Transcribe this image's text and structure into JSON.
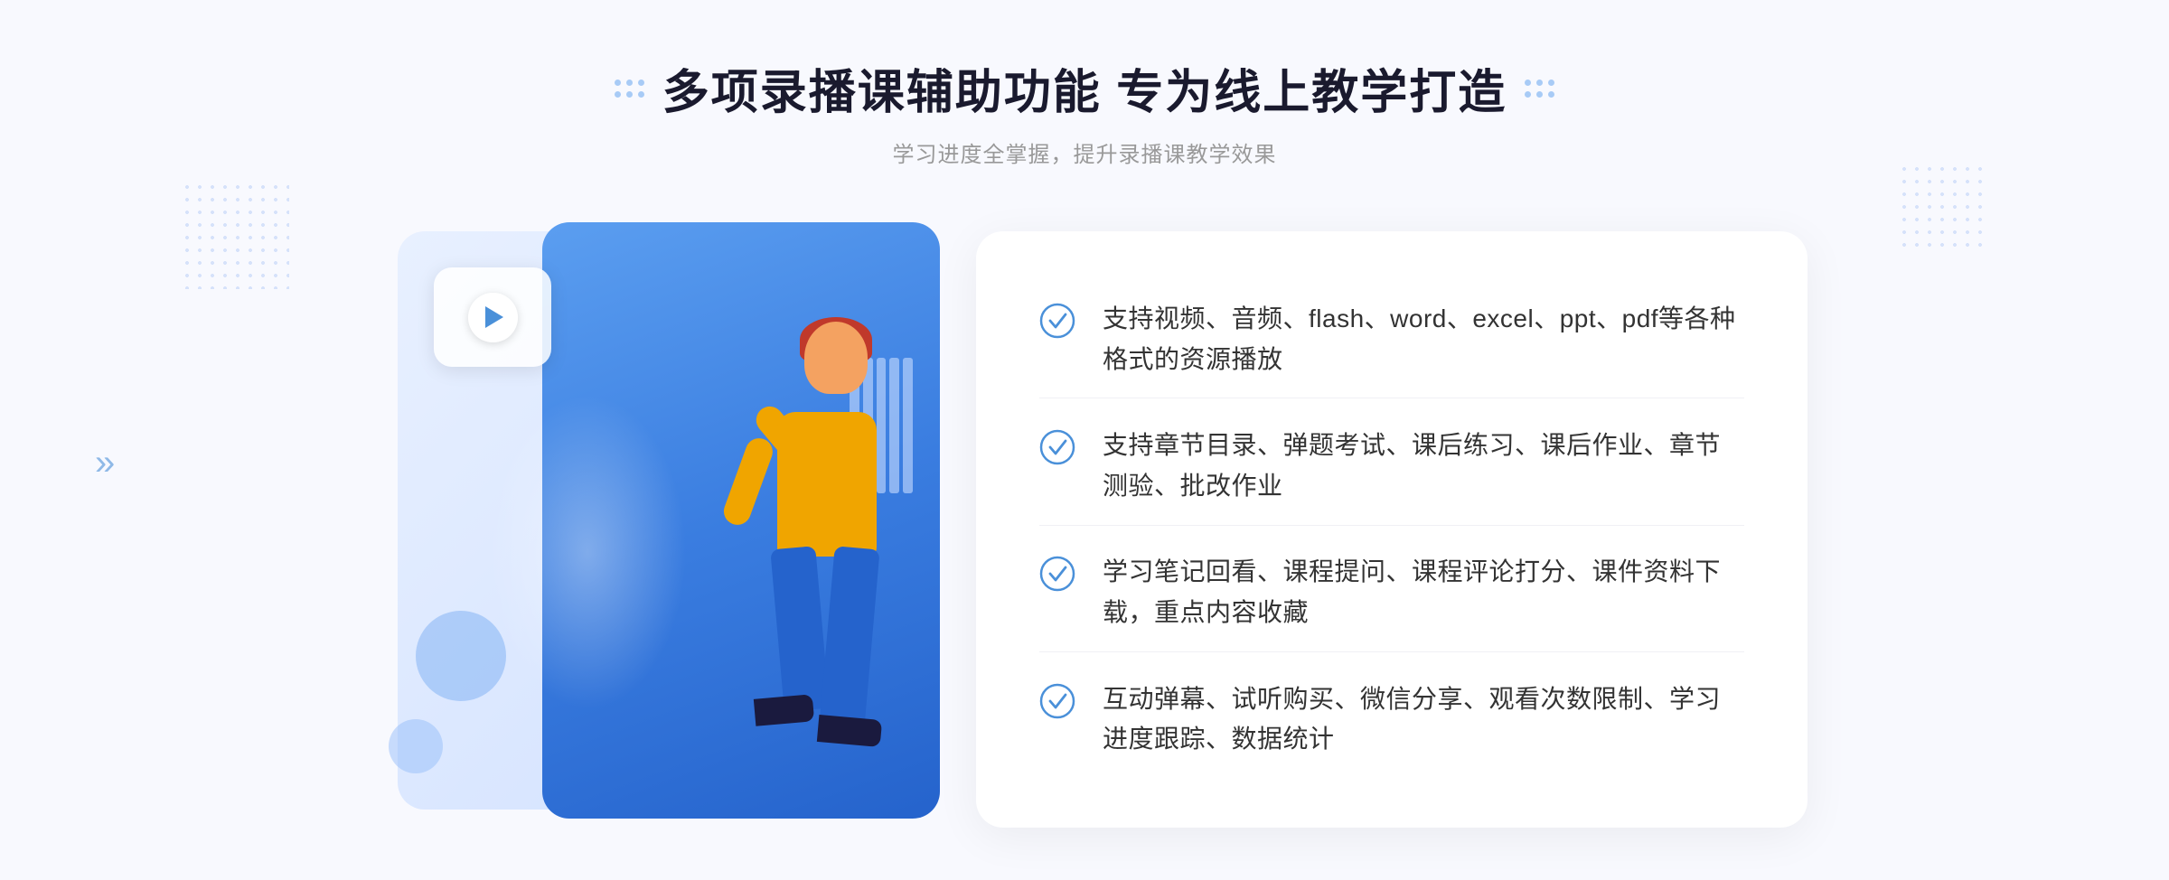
{
  "page": {
    "background": "#f8f9fe"
  },
  "header": {
    "main_title": "多项录播课辅助功能 专为线上教学打造",
    "sub_title": "学习进度全掌握，提升录播课教学效果"
  },
  "features": [
    {
      "id": "feature-1",
      "text": "支持视频、音频、flash、word、excel、ppt、pdf等各种格式的资源播放"
    },
    {
      "id": "feature-2",
      "text": "支持章节目录、弹题考试、课后练习、课后作业、章节测验、批改作业"
    },
    {
      "id": "feature-3",
      "text": "学习笔记回看、课程提问、课程评论打分、课件资料下载，重点内容收藏"
    },
    {
      "id": "feature-4",
      "text": "互动弹幕、试听购买、微信分享、观看次数限制、学习进度跟踪、数据统计"
    }
  ],
  "icons": {
    "check": "check-circle-icon",
    "play": "play-icon",
    "chevron": "chevron-right-icon"
  },
  "colors": {
    "primary": "#4a90d9",
    "dark_blue": "#2563cc",
    "title": "#1a1a2e",
    "text": "#333333",
    "subtitle": "#999999",
    "bg": "#f8f9fe"
  }
}
